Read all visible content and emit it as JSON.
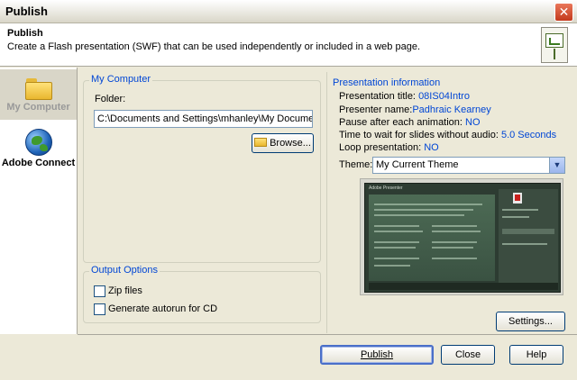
{
  "window": {
    "title": "Publish",
    "close_glyph": "✕"
  },
  "header": {
    "title": "Publish",
    "description": "Create a Flash presentation (SWF) that can be used independently or included in a web page.",
    "icon": "presentation-board-icon"
  },
  "nav": {
    "items": [
      {
        "label": "My Computer",
        "icon": "folder-icon",
        "selected": true
      },
      {
        "label": "Adobe Connect",
        "icon": "globe-icon",
        "selected": false
      }
    ]
  },
  "my_computer": {
    "legend": "My Computer",
    "folder_label": "Folder:",
    "folder_value": "C:\\Documents and Settings\\mhanley\\My Documents\\",
    "browse_label": "Browse..."
  },
  "output_options": {
    "legend": "Output Options",
    "zip_label": "Zip files",
    "zip_checked": false,
    "autorun_label": "Generate autorun for CD",
    "autorun_checked": false
  },
  "presentation_info": {
    "heading": "Presentation information",
    "rows": [
      {
        "label": "Presentation title: ",
        "value": "08IS04Intro"
      },
      {
        "label": "Presenter name:",
        "value": "Padhraic Kearney"
      },
      {
        "label": "Pause after each animation: ",
        "value": "NO"
      },
      {
        "label": "Time to wait for slides without audio: ",
        "value": "5.0 Seconds"
      },
      {
        "label": "Loop presentation: ",
        "value": "NO"
      }
    ],
    "theme_label": "Theme:",
    "theme_value": "My Current Theme",
    "preview_title": "Adobe Presenter",
    "settings_label": "Settings..."
  },
  "footer": {
    "publish_label": "Publish",
    "close_label": "Close",
    "help_label": "Help"
  },
  "colors": {
    "accent": "#0046d5",
    "dialog_bg": "#ece9d8",
    "close_button": "#c3391c"
  }
}
